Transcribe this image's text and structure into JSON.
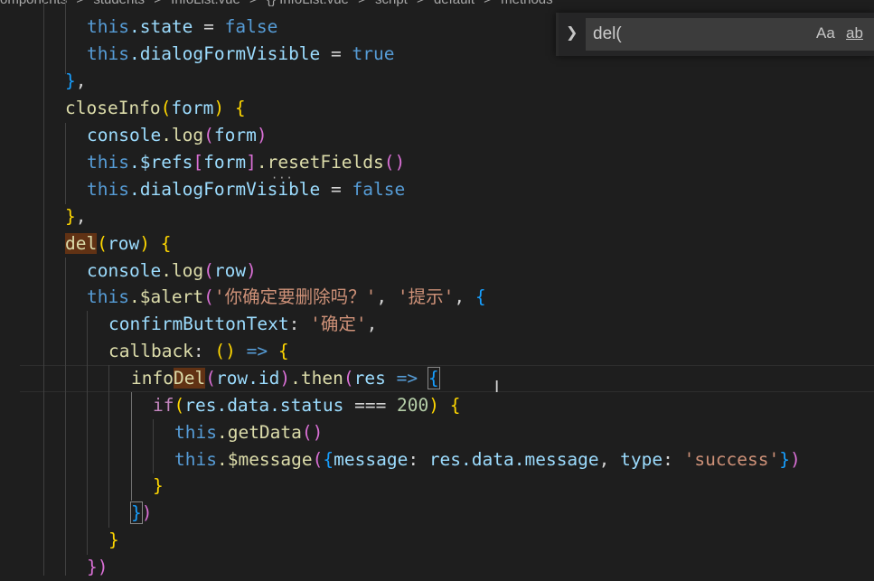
{
  "breadcrumb": {
    "items": [
      "omponents",
      ">",
      "students",
      ">",
      "InfoList.vue",
      ">",
      "{} InfoList.vue",
      ">",
      "script",
      ">",
      "default",
      ">",
      "methods"
    ]
  },
  "find": {
    "query": "del(",
    "toggle_icon": "chevron-right",
    "match_case_label": "Aa",
    "whole_word_label": "ab"
  },
  "code": {
    "line_1_obj": "this",
    "line_1_prop": ".state",
    "line_1_op": " = ",
    "line_1_val": "false",
    "line_2_obj": "this",
    "line_2_prop": ".dialogFormVisible",
    "line_2_op": " = ",
    "line_2_val": "true",
    "line_3_close": "}",
    "line_3_comma": ",",
    "line_4_name": "closeInfo",
    "line_4_paren_open": "(",
    "line_4_param": "form",
    "line_4_paren_close": ")",
    "line_4_brace": " {",
    "line_5_obj": "console",
    "line_5_method": ".log",
    "line_5_po": "(",
    "line_5_arg": "form",
    "line_5_pc": ")",
    "line_6_obj": "this",
    "line_6_prop": ".$refs",
    "line_6_bo": "[",
    "line_6_key": "form",
    "line_6_bc": "]",
    "line_6_method": ".resetFields",
    "line_6_call": "()",
    "line_7_obj": "this",
    "line_7_prop": ".dialogFormVisible",
    "line_7_op": " = ",
    "line_7_val": "false",
    "line_8_close": "}",
    "line_8_comma": ",",
    "line_9_name": "del",
    "line_9_paren_open": "(",
    "line_9_param": "row",
    "line_9_paren_close": ")",
    "line_9_brace": " {",
    "line_10_obj": "console",
    "line_10_method": ".log",
    "line_10_po": "(",
    "line_10_arg": "row",
    "line_10_pc": ")",
    "line_11_obj": "this",
    "line_11_method": ".$alert",
    "line_11_po": "(",
    "line_11_str1": "'你确定要删除吗？'",
    "line_11_sep": ", ",
    "line_11_str2": "'提示'",
    "line_11_sep2": ", ",
    "line_11_brace": "{",
    "line_12_key": "confirmButtonText",
    "line_12_colon": ": ",
    "line_12_val": "'确定'",
    "line_12_comma": ",",
    "line_13_key": "callback",
    "line_13_colon": ": ",
    "line_13_params": "()",
    "line_13_arrow": " => ",
    "line_13_brace": "{",
    "line_14_fn_a": "info",
    "line_14_fn_b": "Del",
    "line_14_po": "(",
    "line_14_arg_obj": "row",
    "line_14_arg_prop": ".id",
    "line_14_pc": ")",
    "line_14_then": ".then",
    "line_14_po2": "(",
    "line_14_param": "res",
    "line_14_arrow": " => ",
    "line_14_brace": "{",
    "line_15_if": "if",
    "line_15_po": "(",
    "line_15_cond": "res.data.status",
    "line_15_op": " === ",
    "line_15_num": "200",
    "line_15_pc": ")",
    "line_15_brace": " {",
    "line_16_obj": "this",
    "line_16_method": ".getData",
    "line_16_call": "()",
    "line_17_obj": "this",
    "line_17_method": ".$message",
    "line_17_po": "(",
    "line_17_bo": "{",
    "line_17_k1": "message",
    "line_17_c1": ": ",
    "line_17_v1": "res.data.message",
    "line_17_sep": ", ",
    "line_17_k2": "type",
    "line_17_c2": ": ",
    "line_17_v2": "'success'",
    "line_17_bc": "}",
    "line_17_pc": ")",
    "line_18_close": "}",
    "line_19_brace": "}",
    "line_19_paren": ")",
    "line_20_close": "}",
    "line_21_close": "})"
  },
  "colors": {
    "background": "#1e1e1e",
    "keyword": "#569cd6",
    "function": "#dcdcaa",
    "variable": "#9cdcfe",
    "string": "#ce9178",
    "number": "#b5cea8",
    "search_highlight": "#613214"
  }
}
